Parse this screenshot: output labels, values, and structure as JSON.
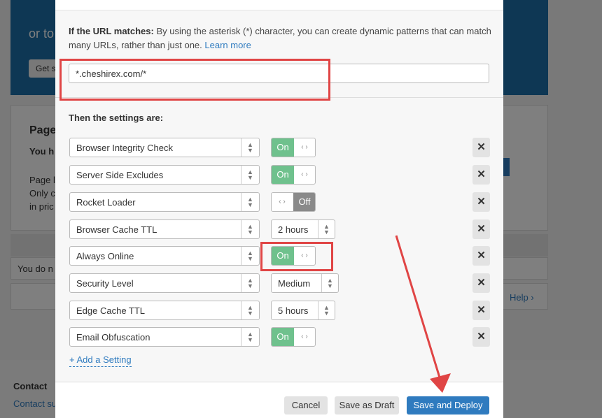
{
  "background": {
    "hero_text": "or to",
    "hero_button": "Get s",
    "card_title": "Page",
    "card_subtitle": "You h",
    "card_text": "Page l\nOnly c\nin pric",
    "row_text": "You do n",
    "help_link": "Help ›",
    "footer_title": "Contact",
    "footer_link": "Contact su"
  },
  "url_section": {
    "label": "If the URL matches:",
    "description": " By using the asterisk (*) character, you can create dynamic patterns that can match many URLs, rather than just one. ",
    "learn_more": "Learn more",
    "url_value": "*.cheshirex.com/*"
  },
  "settings": {
    "title": "Then the settings are:",
    "rows": [
      {
        "name": "Browser Integrity Check",
        "type": "toggle",
        "value": "On"
      },
      {
        "name": "Server Side Excludes",
        "type": "toggle",
        "value": "On"
      },
      {
        "name": "Rocket Loader",
        "type": "toggle",
        "value": "Off"
      },
      {
        "name": "Browser Cache TTL",
        "type": "select",
        "value": "2 hours"
      },
      {
        "name": "Always Online",
        "type": "toggle",
        "value": "On"
      },
      {
        "name": "Security Level",
        "type": "select",
        "value": "Medium"
      },
      {
        "name": "Edge Cache TTL",
        "type": "select",
        "value": "5 hours"
      },
      {
        "name": "Email Obfuscation",
        "type": "toggle",
        "value": "On"
      }
    ],
    "add_setting": "+ Add a Setting",
    "remove_symbol": "✕"
  },
  "footer": {
    "cancel": "Cancel",
    "save_draft": "Save as Draft",
    "save_deploy": "Save and Deploy"
  },
  "colors": {
    "accent": "#2f7bbf",
    "toggle_on": "#6fc18d",
    "toggle_off": "#8a8a8a",
    "annotation": "#e04545"
  }
}
